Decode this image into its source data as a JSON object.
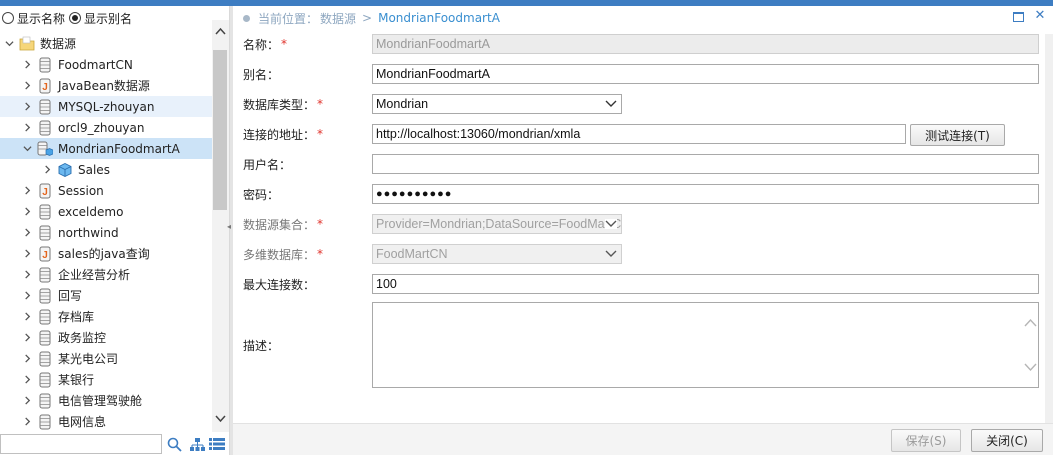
{
  "left_panel": {
    "radio_name_label": "显示名称",
    "radio_alias_label": "显示别名",
    "tree": {
      "root_label": "数据源",
      "items": [
        {
          "label": "FoodmartCN",
          "icon": "database-icon"
        },
        {
          "label": "JavaBean数据源",
          "icon": "java-icon"
        },
        {
          "label": "MYSQL-zhouyan",
          "icon": "database-icon"
        },
        {
          "label": "orcl9_zhouyan",
          "icon": "database-icon"
        },
        {
          "label": "MondrianFoodmartA",
          "icon": "cube-database-icon"
        },
        {
          "label": "Sales",
          "icon": "cube-icon"
        },
        {
          "label": "Session",
          "icon": "java-icon"
        },
        {
          "label": "exceldemo",
          "icon": "database-icon"
        },
        {
          "label": "northwind",
          "icon": "database-icon"
        },
        {
          "label": "sales的java查询",
          "icon": "java-icon"
        },
        {
          "label": "企业经营分析",
          "icon": "database-icon"
        },
        {
          "label": "回写",
          "icon": "database-icon"
        },
        {
          "label": "存档库",
          "icon": "database-icon"
        },
        {
          "label": "政务监控",
          "icon": "database-icon"
        },
        {
          "label": "某光电公司",
          "icon": "database-icon"
        },
        {
          "label": "某银行",
          "icon": "database-icon"
        },
        {
          "label": "电信管理驾驶舱",
          "icon": "database-icon"
        },
        {
          "label": "电网信息",
          "icon": "database-icon"
        }
      ]
    },
    "search_placeholder": ""
  },
  "breadcrumb": {
    "prefix": "当前位置：",
    "parent": "数据源",
    "separator": ">",
    "current": "MondrianFoodmartA"
  },
  "form": {
    "name_label": "名称：",
    "name_value": "MondrianFoodmartA",
    "alias_label": "别名：",
    "alias_value": "MondrianFoodmartA",
    "dbtype_label": "数据库类型：",
    "dbtype_value": "Mondrian",
    "url_label": "连接的地址：",
    "url_value": "http://localhost:13060/mondrian/xmla",
    "test_button": "测试连接(T)",
    "user_label": "用户名：",
    "user_value": "",
    "password_label": "密码：",
    "password_value": "●●●●●●●●●●",
    "datasource_set_label": "数据源集合：",
    "datasource_set_value": "Provider=Mondrian;DataSource=FoodMartC",
    "cube_db_label": "多维数据库：",
    "cube_db_value": "FoodMartCN",
    "maxconn_label": "最大连接数：",
    "maxconn_value": "100",
    "desc_label": "描述：",
    "desc_value": ""
  },
  "footer": {
    "save_label": "保存(S)",
    "close_label": "关闭(C)"
  },
  "colors": {
    "accent": "#3d7dc2",
    "required": "#e0322b",
    "breadcrumb_current": "#3a8fd0",
    "selected_row": "#cce3f7"
  }
}
